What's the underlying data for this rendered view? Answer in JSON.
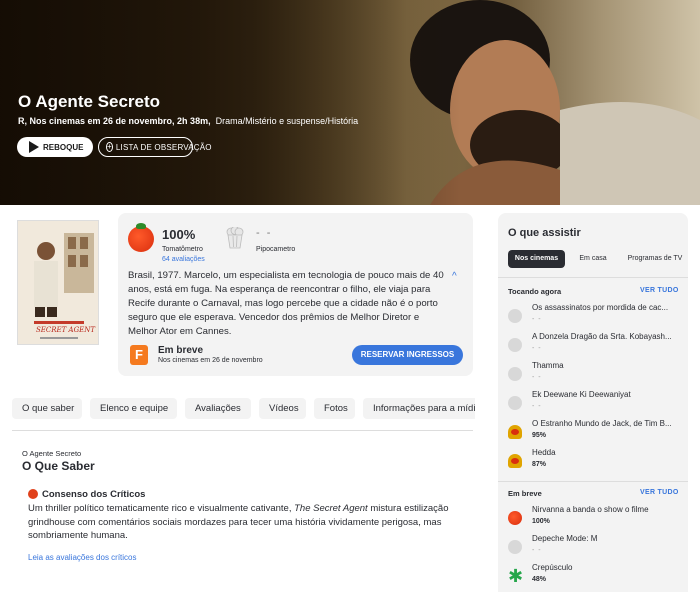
{
  "hero": {
    "title": "O Agente Secreto",
    "meta_bold": "R, Nos cinemas em 26 de novembro, 2h 38m,",
    "meta_genre": "Drama/Mistério e suspense/História",
    "trailer_label": "REBOQUE",
    "watchlist_label": "LISTA DE OBSERVAÇÃO"
  },
  "poster": {
    "caption": "SECRET AGENT"
  },
  "scores": {
    "tomatometer_value": "100%",
    "tomatometer_label": "Tomatômetro",
    "reviews_count": "64 avaliações",
    "popcorn_value": "- -",
    "popcorn_label": "Pipocametro"
  },
  "synopsis": "Brasil, 1977. Marcelo, um especialista em tecnologia de pouco mais de 40 anos, está em fuga. Na esperança de reencontrar o filho, ele viaja para Recife durante o Carnaval, mas logo percebe que a cidade não é o porto seguro que ele esperava. Vencedor dos prêmios de Melhor Diretor e Melhor Ator em Cannes.",
  "release": {
    "title": "Em breve",
    "subtitle": "Nos cinemas em 26 de novembro",
    "tickets_label": "RESERVAR INGRESSOS"
  },
  "nav_tabs": [
    "O que saber",
    "Elenco e equipe",
    "Avaliações",
    "Vídeos",
    "Fotos",
    "Informações para a mídia"
  ],
  "what_to_know": {
    "kicker": "O Agente Secreto",
    "title": "O Que Saber",
    "consensus_title": "Consenso dos Críticos",
    "consensus_pre": "Um thriller político tematicamente rico e visualmente cativante,",
    "consensus_italic": "The Secret Agent",
    "consensus_post": "mistura estilização grindhouse com comentários sociais mordazes para tecer uma história vividamente perigosa, mas sombriamente humana.",
    "read_reviews": "Leia as avaliações dos críticos"
  },
  "sidebar": {
    "title": "O que assistir",
    "tabs": [
      "Nos cinemas",
      "Em casa",
      "Programas de TV"
    ],
    "now_playing_label": "Tocando agora",
    "coming_soon_label": "Em breve",
    "see_all": "VER TUDO",
    "now_playing": [
      {
        "name": "Os assassinatos por mordida de cac...",
        "score": "- -",
        "icon": "empty-score-icon"
      },
      {
        "name": "A Donzela Dragão da Srta. Kobayash...",
        "score": "- -",
        "icon": "empty-score-icon"
      },
      {
        "name": "Thamma",
        "score": "- -",
        "icon": "empty-score-icon"
      },
      {
        "name": "Ek Deewane Ki Deewaniyat",
        "score": "- -",
        "icon": "empty-score-icon"
      },
      {
        "name": "O Estranho Mundo de Jack, de Tim B...",
        "score": "95%",
        "icon": "certified-fresh-icon"
      },
      {
        "name": "Hedda",
        "score": "87%",
        "icon": "certified-fresh-icon"
      }
    ],
    "coming_soon": [
      {
        "name": "Nirvanna a banda o show o filme",
        "score": "100%",
        "icon": "tomato-icon"
      },
      {
        "name": "Depeche Mode: M",
        "score": "- -",
        "icon": "empty-score-icon"
      },
      {
        "name": "Crepúsculo",
        "score": "48%",
        "icon": "rotten-splat-icon"
      }
    ]
  }
}
